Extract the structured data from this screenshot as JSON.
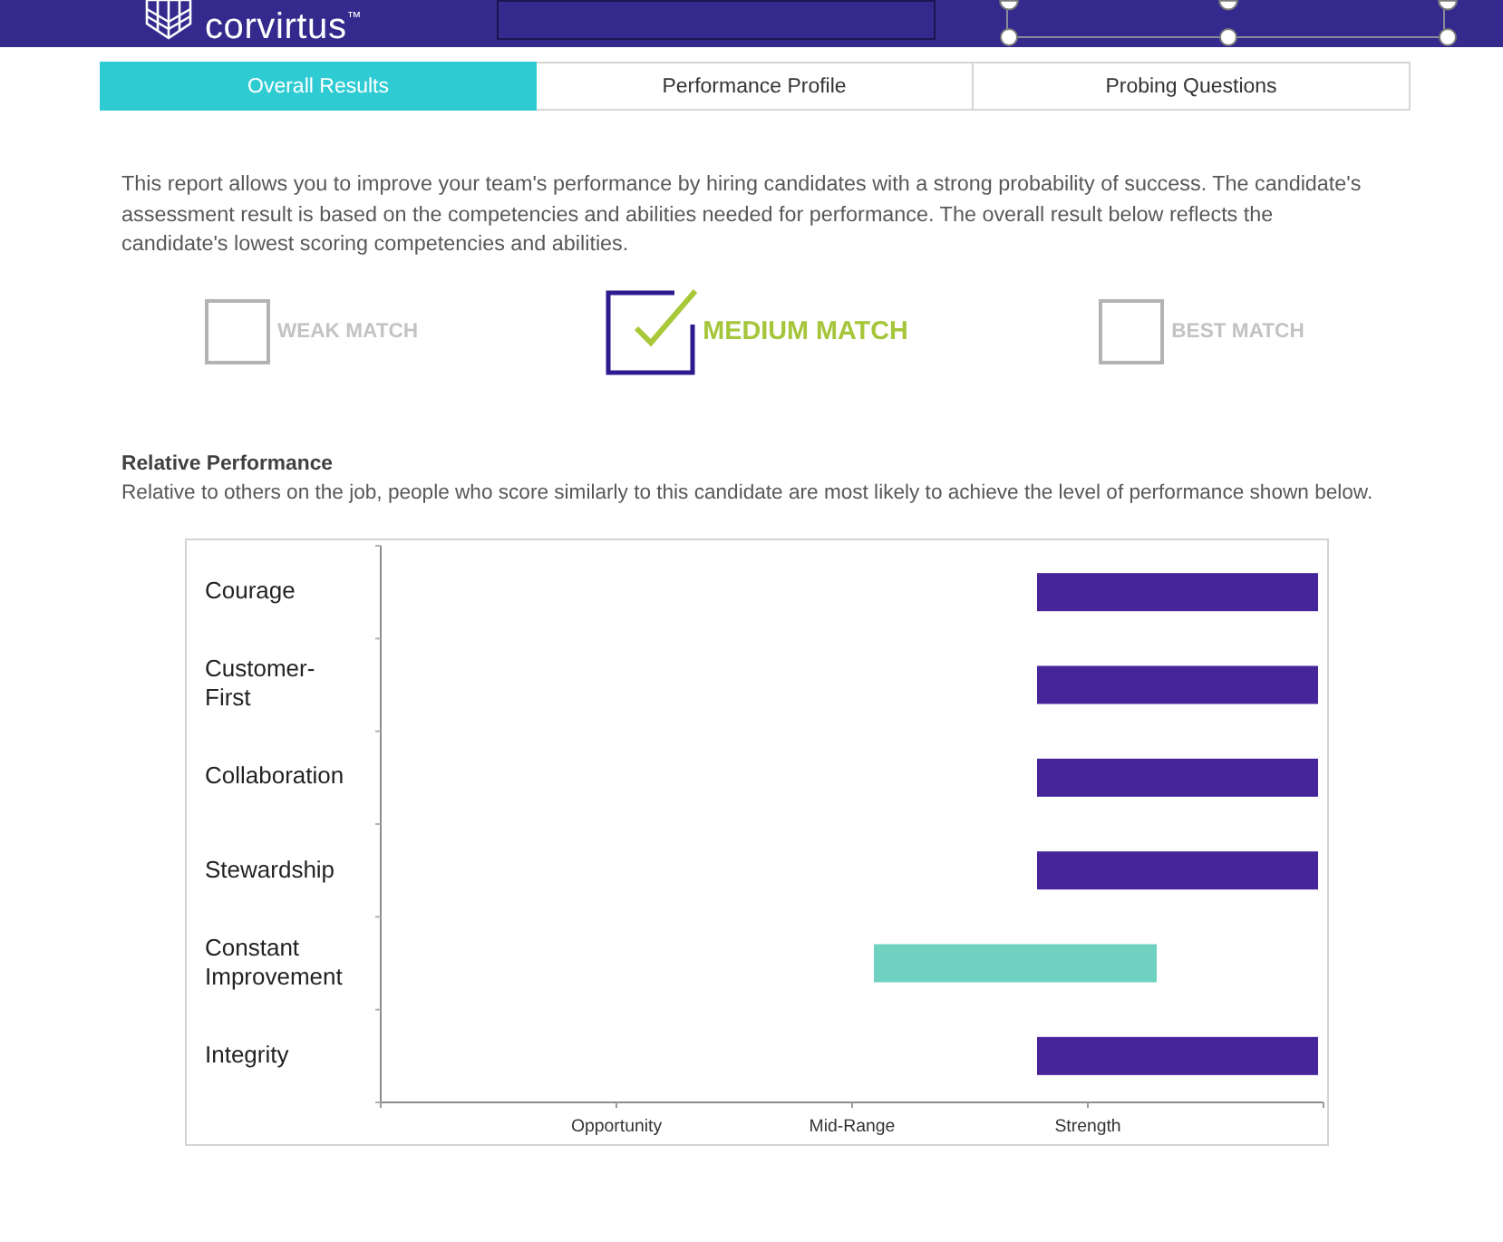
{
  "header": {
    "logo": "corvirtus$^{™}$"
  },
  "tabs": [
    {
      "label": "Overall Results",
      "selected": true
    },
    {
      "label": "Performance Profile",
      "selected": false
    },
    {
      "label": "Probing Questions",
      "selected": false
    }
  ],
  "intro": "This report allows you to improve your team's performance by hiring candidates with a strong probability of success. The candidate's assessment result is based on the competencies and abilities needed for performance. The overall result below reflects the candidate's lowest scoring competencies and abilities.",
  "match_levels": [
    {
      "label": "WEAK MATCH",
      "selected": false
    },
    {
      "label": "MEDIUM MATCH",
      "selected": true
    },
    {
      "label": "BEST MATCH",
      "selected": false
    }
  ],
  "relative_performance": {
    "title": "Relative Performance",
    "description": "Relative to others on the job, people who score similarly to this candidate are most likely to achieve the level of performance shown below.",
    "chart": {
      "rows": [
        {
          "label": "Courage",
          "color": "#46249a"
        },
        {
          "label": "Customer-First",
          "color": "#46249a"
        },
        {
          "label": "Collaboration",
          "color": "#46249a"
        },
        {
          "label": "Stewardship",
          "color": "#46249a"
        },
        {
          "label": "Constant Improvement",
          "color": "#6fd1bf"
        },
        {
          "label": "Integrity",
          "color": "#46249a"
        }
      ],
      "axis_labels": [
        "Opportunity",
        "Mid-Range",
        "Strength"
      ]
    }
  }
}
